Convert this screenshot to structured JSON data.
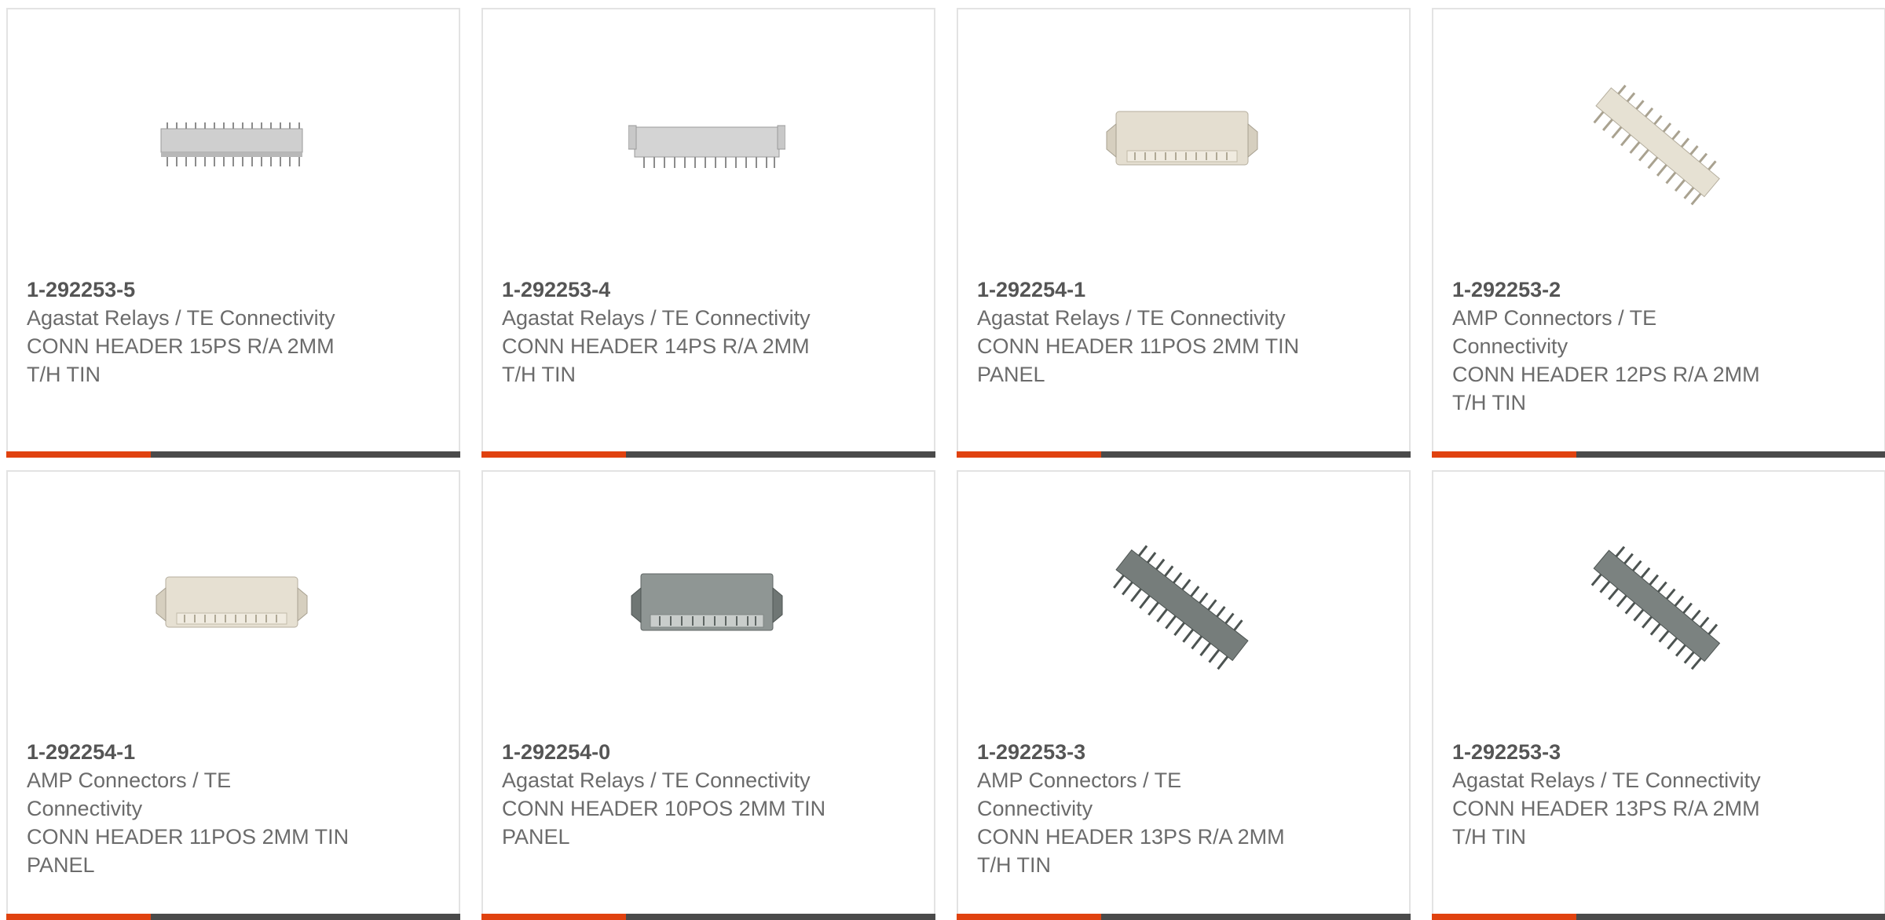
{
  "products": [
    {
      "part_number": "1-292253-5",
      "manufacturer": "Agastat Relays / TE Connectivity",
      "description": "CONN HEADER 15PS R/A 2MM T/H TIN",
      "image_icon": "connector-header-image"
    },
    {
      "part_number": "1-292253-4",
      "manufacturer": "Agastat Relays / TE Connectivity",
      "description": "CONN HEADER 14PS R/A 2MM T/H TIN",
      "image_icon": "connector-header-image"
    },
    {
      "part_number": "1-292254-1",
      "manufacturer": "Agastat Relays / TE Connectivity",
      "description": "CONN HEADER 11POS 2MM TIN PANEL",
      "image_icon": "connector-panel-image"
    },
    {
      "part_number": "1-292253-2",
      "manufacturer": "AMP Connectors / TE Connectivity",
      "description": "CONN HEADER 12PS R/A 2MM T/H TIN",
      "image_icon": "connector-header-angled-image"
    },
    {
      "part_number": "1-292254-1",
      "manufacturer": "AMP Connectors / TE Connectivity",
      "description": "CONN HEADER 11POS 2MM TIN PANEL",
      "image_icon": "connector-panel-image"
    },
    {
      "part_number": "1-292254-0",
      "manufacturer": "Agastat Relays / TE Connectivity",
      "description": "CONN HEADER 10POS 2MM TIN PANEL",
      "image_icon": "connector-panel-dark-image"
    },
    {
      "part_number": "1-292253-3",
      "manufacturer": "AMP Connectors / TE Connectivity",
      "description": "CONN HEADER 13PS R/A 2MM T/H TIN",
      "image_icon": "connector-header-angled-dark-image"
    },
    {
      "part_number": "1-292253-3",
      "manufacturer": "Agastat Relays / TE Connectivity",
      "description": "CONN HEADER 13PS R/A 2MM T/H TIN",
      "image_icon": "connector-header-angled-dark-image"
    }
  ],
  "colors": {
    "accent": "#e0420f",
    "bar": "#4a4a4a",
    "border": "#e3e3e3",
    "text": "#6b6b6b"
  }
}
